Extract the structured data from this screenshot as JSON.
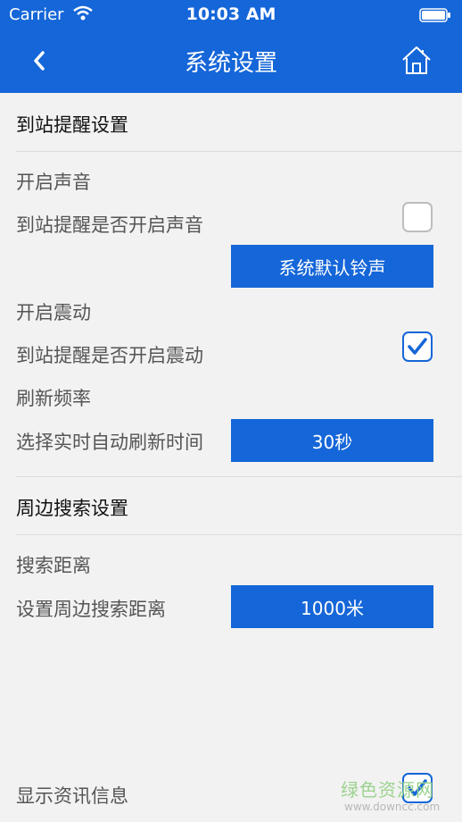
{
  "status_bar": {
    "carrier": "Carrier",
    "time": "10:03 AM",
    "wifi_icon": "wifi-icon",
    "battery_icon": "battery-icon"
  },
  "nav": {
    "title": "系统设置",
    "back_icon": "chevron-left-icon",
    "home_icon": "home-icon"
  },
  "arrival": {
    "section_title": "到站提醒设置",
    "sound": {
      "title": "开启声音",
      "label": "到站提醒是否开启声音",
      "checked": false,
      "ringtone_button": "系统默认铃声"
    },
    "vibrate": {
      "title": "开启震动",
      "label": "到站提醒是否开启震动",
      "checked": true
    },
    "refresh": {
      "title": "刷新频率",
      "label": "选择实时自动刷新时间",
      "value": "30秒"
    }
  },
  "nearby": {
    "section_title": "周边搜索设置",
    "distance": {
      "title": "搜索距离",
      "label": "设置周边搜索距离",
      "value": "1000米"
    }
  },
  "news": {
    "label": "显示资讯信息",
    "checked": true
  },
  "watermark": {
    "main": "绿色资源网",
    "sub": "www.downcc.com"
  },
  "colors": {
    "accent": "#1566d8",
    "background": "#f2f2f2"
  }
}
